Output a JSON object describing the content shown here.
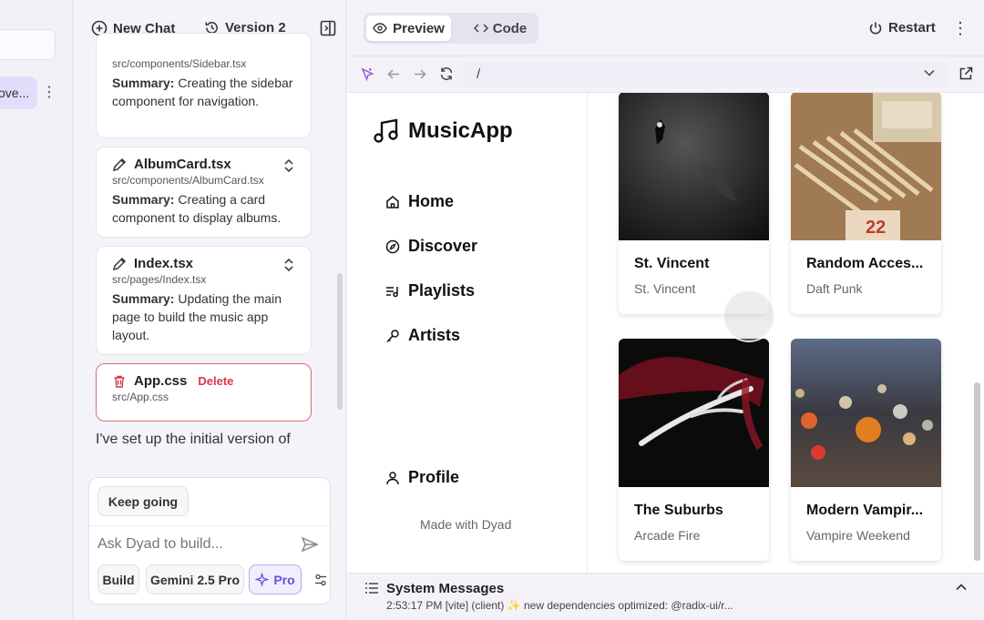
{
  "left_strip": {
    "chip_text": "ove..."
  },
  "chat_header": {
    "new_chat": "New Chat",
    "version": "Version 2"
  },
  "cards": [
    {
      "title": "",
      "path": "src/components/Sidebar.tsx",
      "summary_label": "Summary:",
      "summary": "Creating the sidebar component for navigation."
    },
    {
      "title": "AlbumCard.tsx",
      "path": "src/components/AlbumCard.tsx",
      "summary_label": "Summary:",
      "summary": "Creating a card component to display albums."
    },
    {
      "title": "Index.tsx",
      "path": "src/pages/Index.tsx",
      "summary_label": "Summary:",
      "summary": "Updating the main page to build the music app layout."
    },
    {
      "title": "App.css",
      "action": "Delete",
      "path": "src/App.css"
    }
  ],
  "chat_message": "I've set up the initial version of",
  "composer": {
    "keep_going": "Keep going",
    "placeholder": "Ask Dyad to build...",
    "mode": "Build",
    "model": "Gemini 2.5 Pro",
    "pro": "Pro"
  },
  "preview_bar": {
    "preview_tab": "Preview",
    "code_tab": "Code",
    "restart": "Restart",
    "url": "/"
  },
  "app": {
    "name": "MusicApp",
    "nav": [
      "Home",
      "Discover",
      "Playlists",
      "Artists"
    ],
    "profile": "Profile",
    "footer": "Made with Dyad",
    "albums": [
      {
        "title": "St. Vincent",
        "artist": "St. Vincent"
      },
      {
        "title": "Random Acces...",
        "artist": "Daft Punk"
      },
      {
        "title": "The Suburbs",
        "artist": "Arcade Fire"
      },
      {
        "title": "Modern Vampir...",
        "artist": "Vampire Weekend"
      }
    ]
  },
  "system": {
    "title": "System Messages",
    "message": "2:53:17 PM [vite] (client) ✨ new dependencies optimized: @radix-ui/r..."
  },
  "colors": {
    "accent": "#7c5ce0",
    "delete": "#d9364a",
    "panel": "#f4f2f8"
  }
}
